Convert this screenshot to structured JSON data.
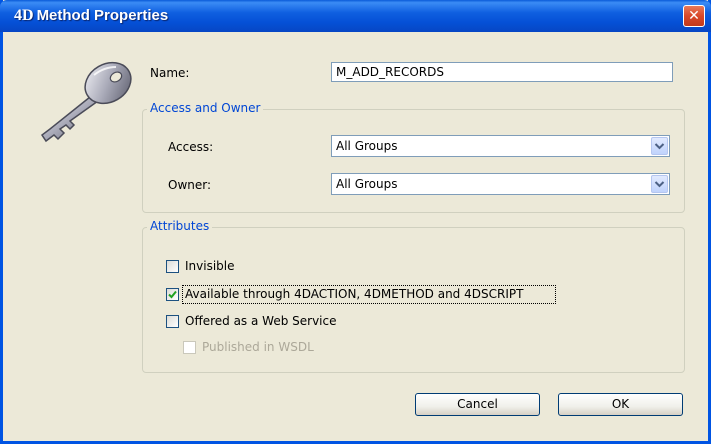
{
  "window": {
    "title_logo": "4D",
    "title": "Method Properties",
    "close_glyph": "✕"
  },
  "icon": {
    "name": "key-icon"
  },
  "name_field": {
    "label": "Name:",
    "value": "M_ADD_RECORDS"
  },
  "access_owner": {
    "legend": "Access and Owner",
    "access": {
      "label": "Access:",
      "value": "All Groups"
    },
    "owner": {
      "label": "Owner:",
      "value": "All Groups"
    }
  },
  "attributes": {
    "legend": "Attributes",
    "items": [
      {
        "label": "Invisible",
        "checked": false,
        "enabled": true
      },
      {
        "label": "Available through 4DACTION, 4DMETHOD and 4DSCRIPT",
        "checked": true,
        "enabled": true
      },
      {
        "label": "Offered as a Web Service",
        "checked": false,
        "enabled": true
      },
      {
        "label": "Published in WSDL",
        "checked": false,
        "enabled": false
      }
    ]
  },
  "buttons": {
    "cancel": "Cancel",
    "ok": "OK"
  },
  "colors": {
    "title_blue": "#0054e3",
    "legend_blue": "#0046d5",
    "face": "#ece9d8",
    "check_green": "#21a121"
  }
}
